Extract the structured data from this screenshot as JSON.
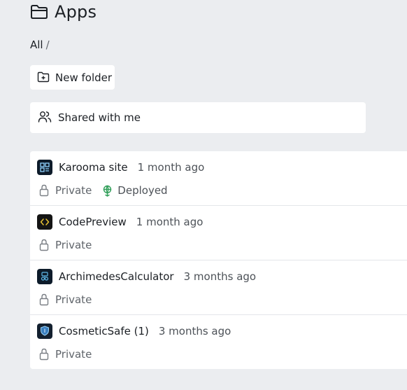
{
  "header": {
    "icon": "folder-icon",
    "title": "Apps"
  },
  "breadcrumb": {
    "root": "All",
    "separator": "/"
  },
  "toolbar": {
    "new_folder_label": "New folder",
    "new_folder_icon": "folder-plus-icon"
  },
  "shared": {
    "label": "Shared with me",
    "icon": "users-icon"
  },
  "apps": [
    {
      "name": "Karooma site",
      "time": "1 month ago",
      "visibility": "Private",
      "status": "Deployed",
      "icon": "layout-grid-icon"
    },
    {
      "name": "CodePreview",
      "time": "1 month ago",
      "visibility": "Private",
      "icon": "code-icon"
    },
    {
      "name": "ArchimedesCalculator",
      "time": "3 months ago",
      "visibility": "Private",
      "icon": "calculator-icon"
    },
    {
      "name": "CosmeticSafe (1)",
      "time": "3 months ago",
      "visibility": "Private",
      "icon": "shield-icon"
    }
  ],
  "colors": {
    "background": "#ebedf0",
    "card": "#ffffff",
    "deployed_green": "#2f9e58",
    "app_icon_bg": "#0d1b2a",
    "code_accent": "#e8c232"
  }
}
